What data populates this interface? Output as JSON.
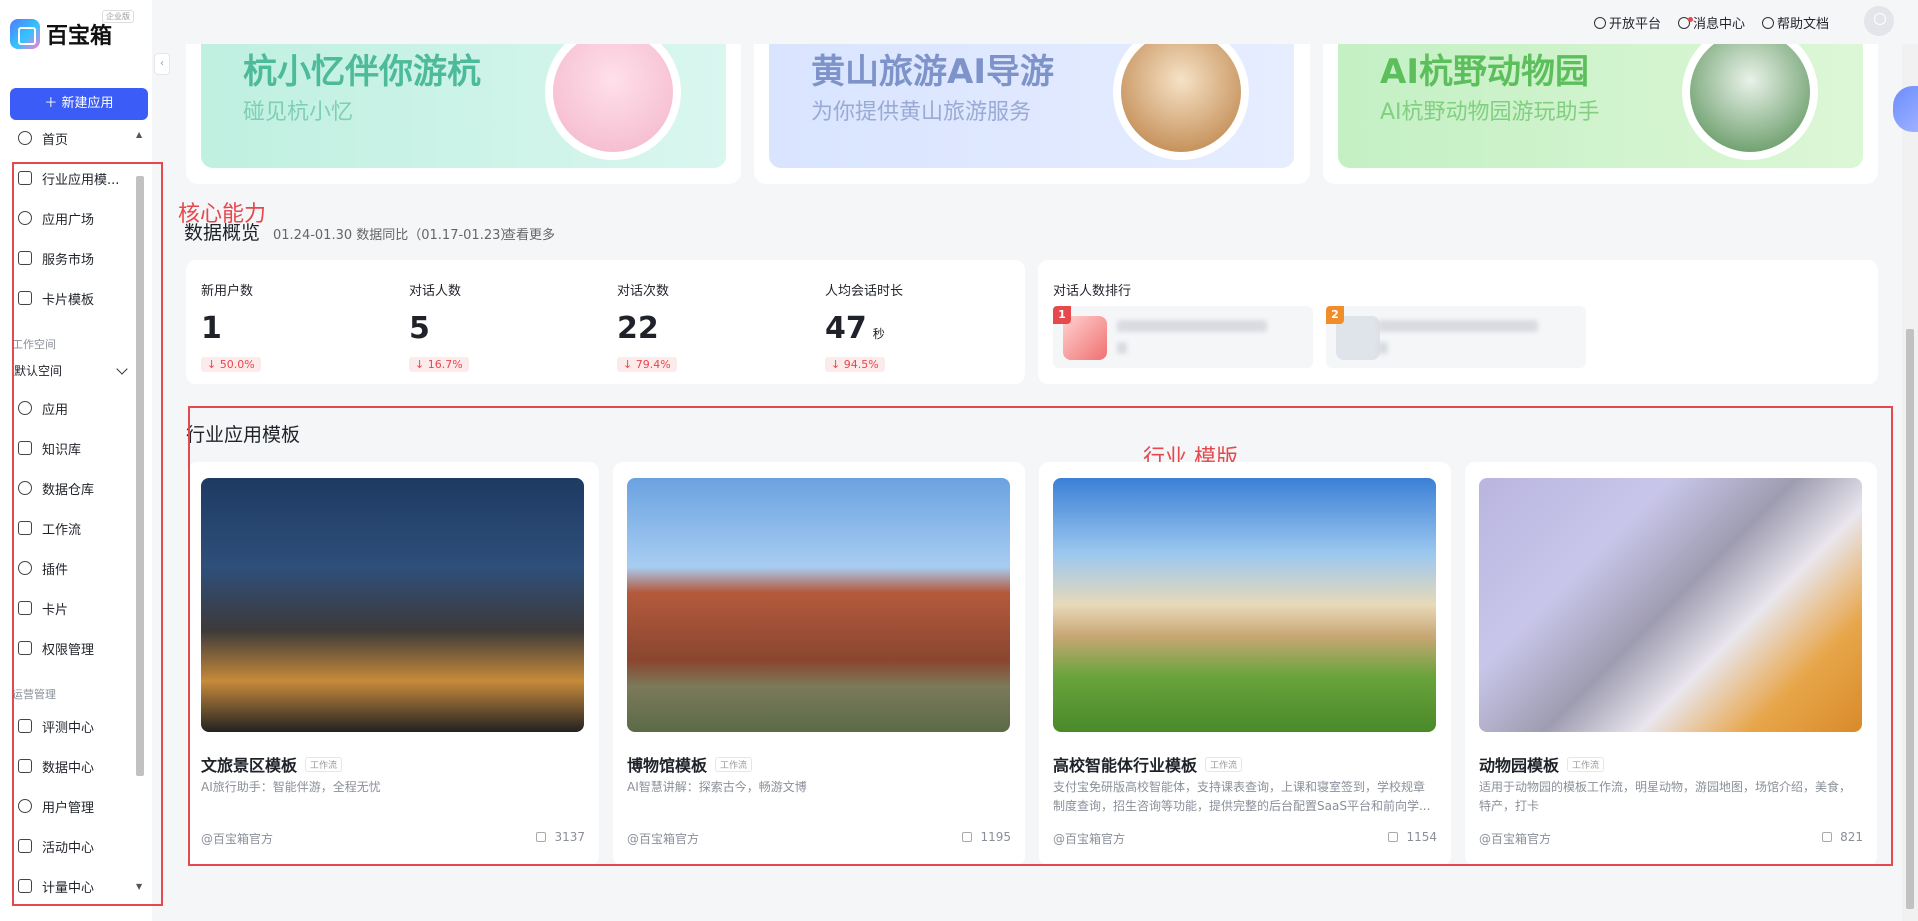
{
  "app": {
    "logo_text": "百宝箱",
    "edition_badge": "企业版",
    "new_app_label": "＋ 新建应用"
  },
  "sidebar": {
    "items_top": [
      {
        "label": "首页",
        "icon": "home-icon"
      },
      {
        "label": "行业应用模...",
        "icon": "template-icon"
      },
      {
        "label": "应用广场",
        "icon": "plaza-icon"
      },
      {
        "label": "服务市场",
        "icon": "market-icon"
      },
      {
        "label": "卡片模板",
        "icon": "card-template-icon"
      }
    ],
    "workspace_section": "工作空间",
    "workspace_select": "默认空间",
    "items_workspace": [
      {
        "label": "应用",
        "icon": "cube-icon"
      },
      {
        "label": "知识库",
        "icon": "book-icon"
      },
      {
        "label": "数据仓库",
        "icon": "database-icon"
      },
      {
        "label": "工作流",
        "icon": "workflow-icon"
      },
      {
        "label": "插件",
        "icon": "plugin-icon"
      },
      {
        "label": "卡片",
        "icon": "card-icon"
      },
      {
        "label": "权限管理",
        "icon": "lock-icon"
      }
    ],
    "ops_section": "运营管理",
    "items_ops": [
      {
        "label": "评测中心",
        "icon": "chart-icon"
      },
      {
        "label": "数据中心",
        "icon": "table-icon"
      },
      {
        "label": "用户管理",
        "icon": "users-icon"
      },
      {
        "label": "活动中心",
        "icon": "flag-icon"
      },
      {
        "label": "计量中心",
        "icon": "meter-icon"
      }
    ]
  },
  "topbar": {
    "open_platform": "开放平台",
    "message_center": "消息中心",
    "help_docs": "帮助文档"
  },
  "banners": [
    {
      "title": "杭小忆伴你游杭",
      "subtitle": "碰见杭小忆"
    },
    {
      "title": "黄山旅游AI导游",
      "subtitle": "为你提供黄山旅游服务"
    },
    {
      "title": "AI杭野动物园",
      "subtitle": "AI杭野动物园游玩助手"
    }
  ],
  "annotations": {
    "core": "核心能力",
    "industry": "行业 模版"
  },
  "overview": {
    "title": "数据概览",
    "range": "01.24-01.30 数据同比（01.17-01.23）",
    "more": "查看更多",
    "stats": [
      {
        "label": "新用户数",
        "value": "1",
        "unit": "",
        "change": "↓ 50.0%"
      },
      {
        "label": "对话人数",
        "value": "5",
        "unit": "",
        "change": "↓ 16.7%"
      },
      {
        "label": "对话次数",
        "value": "22",
        "unit": "",
        "change": "↓ 79.4%"
      },
      {
        "label": "人均会话时长",
        "value": "47",
        "unit": "秒",
        "change": "↓ 94.5%"
      }
    ],
    "ranking_title": "对话人数排行",
    "ranks": [
      "1",
      "2"
    ]
  },
  "templates": {
    "title": "行业应用模板",
    "items": [
      {
        "title": "文旅景区模板",
        "tag": "工作流",
        "desc": "AI旅行助手：智能伴游，全程无忧",
        "author": "@百宝箱官方",
        "count": "3137"
      },
      {
        "title": "博物馆模板",
        "tag": "工作流",
        "desc": "AI智慧讲解：探索古今，畅游文博",
        "author": "@百宝箱官方",
        "count": "1195"
      },
      {
        "title": "高校智能体行业模板",
        "tag": "工作流",
        "desc": "支付宝免研版高校智能体，支持课表查询，上课和寝室签到，学校规章制度查询，招生咨询等功能，提供完整的后台配置SaaS平台和前向学...",
        "author": "@百宝箱官方",
        "count": "1154"
      },
      {
        "title": "动物园模板",
        "tag": "工作流",
        "desc": "适用于动物园的模板工作流，明星动物，游园地图，场馆介绍，美食，特产，打卡",
        "author": "@百宝箱官方",
        "count": "821"
      }
    ]
  }
}
